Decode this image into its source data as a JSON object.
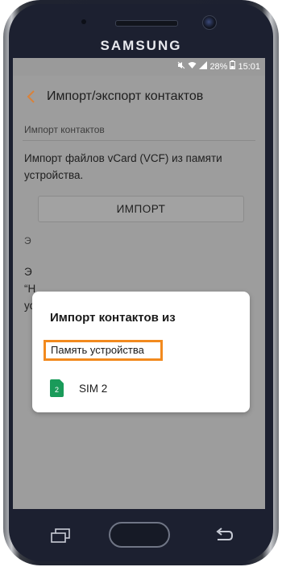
{
  "device": {
    "brand": "SAMSUNG"
  },
  "statusbar": {
    "battery": "28%",
    "time": "15:01"
  },
  "appbar": {
    "title": "Импорт/экспорт контактов",
    "back_icon": "chevron-left-icon"
  },
  "import_section": {
    "header": "Импорт контактов",
    "description": "Импорт файлов vCard (VCF) из памяти устройства.",
    "button_label": "ИМПОРТ"
  },
  "export_section": {
    "header": "Э",
    "description_lines": [
      "Э",
      "“H",
      "ус"
    ]
  },
  "dialog": {
    "title": "Импорт контактов из",
    "options": [
      {
        "label": "Память устройства",
        "highlighted": true
      },
      {
        "label": "SIM 2",
        "icon": "sim-card-icon",
        "sim_number": "2"
      }
    ]
  },
  "colors": {
    "accent_back_arrow": "#d9823a",
    "highlight": "#f28a1e",
    "sim_icon": "#1a9b5a"
  }
}
